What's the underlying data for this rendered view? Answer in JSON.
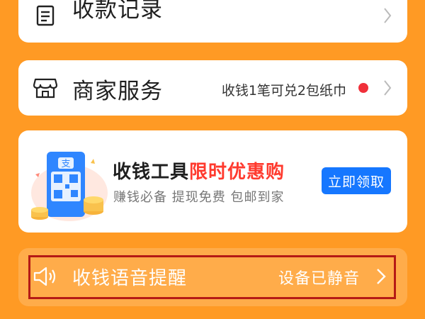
{
  "rows": {
    "record": {
      "label": "收款记录",
      "icon": "receipt-icon"
    },
    "merchant": {
      "label": "商家服务",
      "icon": "store-icon",
      "note": "收钱1笔可兑2包纸巾",
      "dot_color": "#f0303a"
    }
  },
  "promo": {
    "title_part1": "收钱工具",
    "title_highlight": "限时优惠购",
    "subtitle": "赚钱必备 提现免费 包邮到家",
    "button_label": "立即领取",
    "highlight_color": "#ff3a2e",
    "button_color": "#1677ff",
    "illustration_badge": "支"
  },
  "voice": {
    "label": "收钱语音提醒",
    "status": "设备已静音",
    "icon": "speaker-icon"
  },
  "colors": {
    "background": "#ff9a24",
    "card": "#ffffff",
    "highlight_frame": "#b51a16"
  }
}
